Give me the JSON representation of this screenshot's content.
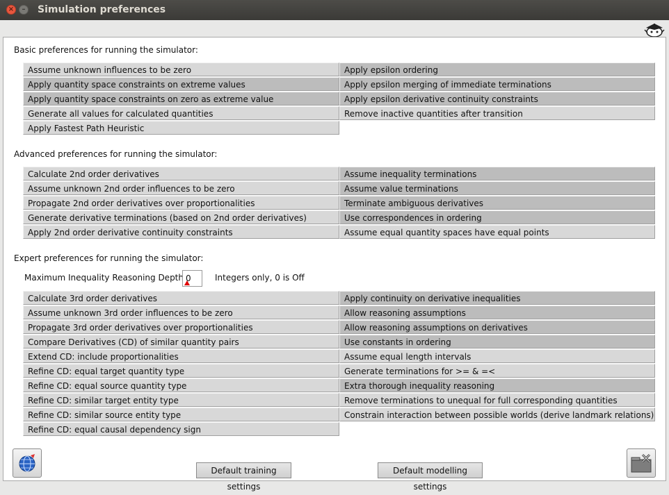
{
  "window": {
    "title": "Simulation preferences"
  },
  "sections": {
    "basic": "Basic preferences for running the simulator:",
    "advanced": "Advanced preferences for running the simulator:",
    "expert": "Expert preferences for running the simulator:"
  },
  "basic_left": [
    {
      "label": "Assume unknown influences to be zero",
      "on": false
    },
    {
      "label": "Apply quantity space constraints on extreme values",
      "on": true
    },
    {
      "label": "Apply quantity space constraints on zero as extreme value",
      "on": true
    },
    {
      "label": "Generate all values for calculated quantities",
      "on": false
    },
    {
      "label": "Apply Fastest Path Heuristic",
      "on": false
    }
  ],
  "basic_right": [
    {
      "label": "Apply epsilon ordering",
      "on": true
    },
    {
      "label": "Apply epsilon merging of immediate terminations",
      "on": true
    },
    {
      "label": "Apply epsilon derivative continuity constraints",
      "on": true
    },
    {
      "label": "Remove inactive quantities after transition",
      "on": false
    }
  ],
  "advanced_left": [
    {
      "label": "Calculate 2nd order derivatives",
      "on": false
    },
    {
      "label": "Assume unknown 2nd order influences to be zero",
      "on": false
    },
    {
      "label": "Propagate 2nd order derivatives over proportionalities",
      "on": false
    },
    {
      "label": "Generate derivative terminations (based on 2nd order derivatives)",
      "on": false
    },
    {
      "label": "Apply 2nd order derivative continuity constraints",
      "on": false
    }
  ],
  "advanced_right": [
    {
      "label": "Assume inequality terminations",
      "on": true
    },
    {
      "label": "Assume value terminations",
      "on": true
    },
    {
      "label": "Terminate ambiguous derivatives",
      "on": true
    },
    {
      "label": "Use correspondences in ordering",
      "on": true
    },
    {
      "label": "Assume equal quantity spaces have equal points",
      "on": false
    }
  ],
  "expert": {
    "depth_label": "Maximum Inequality Reasoning Depth:",
    "depth_value": "0",
    "depth_hint": "Integers only, 0 is Off"
  },
  "expert_left": [
    {
      "label": "Calculate 3rd order derivatives",
      "on": false
    },
    {
      "label": "Assume unknown 3rd order influences to be zero",
      "on": false
    },
    {
      "label": "Propagate 3rd order derivatives over proportionalities",
      "on": false
    },
    {
      "label": "Compare Derivatives (CD) of similar quantity pairs",
      "on": false
    },
    {
      "label": "Extend CD: include proportionalities",
      "on": false
    },
    {
      "label": "Refine CD: equal target quantity type",
      "on": false
    },
    {
      "label": "Refine CD: equal source quantity type",
      "on": false
    },
    {
      "label": "Refine CD: similar target entity type",
      "on": false
    },
    {
      "label": "Refine CD: similar source entity type",
      "on": false
    },
    {
      "label": "Refine CD: equal causal dependency sign",
      "on": false
    }
  ],
  "expert_right": [
    {
      "label": "Apply continuity on derivative inequalities",
      "on": true
    },
    {
      "label": "Allow reasoning assumptions",
      "on": true
    },
    {
      "label": "Allow reasoning assumptions on derivatives",
      "on": true
    },
    {
      "label": "Use constants in ordering",
      "on": true
    },
    {
      "label": "Assume equal length intervals",
      "on": false
    },
    {
      "label": "Generate terminations for >= & =<",
      "on": false
    },
    {
      "label": "Extra thorough inequality reasoning",
      "on": true
    },
    {
      "label": "Remove terminations to unequal for full corresponding quantities",
      "on": false
    },
    {
      "label": "Constrain interaction between possible worlds (derive landmark relations)",
      "on": false
    }
  ],
  "buttons": {
    "training": "Default training settings",
    "modelling": "Default modelling settings"
  },
  "icons": {
    "help": "globe-help-icon",
    "close": "close-folder-icon"
  }
}
